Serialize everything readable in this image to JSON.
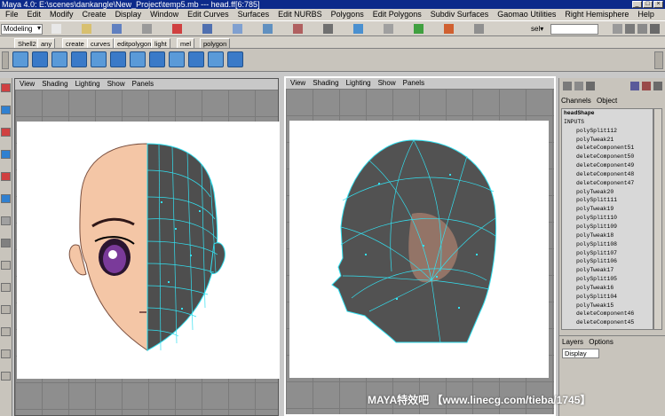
{
  "window": {
    "title": "Maya 4.0: E:\\scenes\\dankangle\\New_Project\\temp5.mb  ---  head.ff[6:785]"
  },
  "menus": [
    "File",
    "Edit",
    "Modify",
    "Create",
    "Display",
    "Window",
    "Edit Curves",
    "Surfaces",
    "Edit NURBS",
    "Polygons",
    "Edit Polygons",
    "Subdiv Surfaces",
    "Gaomao Utilities",
    "Right Hemisphere",
    "Help"
  ],
  "statusline": {
    "mode": "Modeling",
    "sel_label": "sel▾"
  },
  "shelf_tabs": [
    "Shell2",
    "any",
    "create",
    "curves",
    "editpolygon",
    "light",
    "mel",
    "polygon"
  ],
  "panel_menus": [
    "View",
    "Shading",
    "Lighting",
    "Show",
    "Panels"
  ],
  "channel_box": {
    "tabs": [
      "Channels",
      "Object"
    ],
    "items": [
      "headShape",
      "INPUTS",
      "polySplit112",
      "polyTweak21",
      "deleteComponent51",
      "deleteComponent50",
      "deleteComponent49",
      "deleteComponent48",
      "deleteComponent47",
      "polyTweak20",
      "polySplit111",
      "polyTweak19",
      "polySplit110",
      "polySplit109",
      "polyTweak18",
      "polySplit108",
      "polySplit107",
      "polySplit106",
      "polyTweak17",
      "polySplit105",
      "polyTweak16",
      "polySplit104",
      "polyTweak15",
      "deleteComponent46",
      "deleteComponent45"
    ]
  },
  "layers": {
    "tabs": [
      "Layers",
      "Options"
    ],
    "select": "Display"
  },
  "watermark": "MAYA特效吧 【www.linecg.com/tieba/1745】",
  "colors": {
    "title_bg": "#0c2a8a",
    "ui_bg": "#d4d0c8",
    "wire": "#33e0f0",
    "skin": "#f4c6a6",
    "mesh": "#505050"
  }
}
